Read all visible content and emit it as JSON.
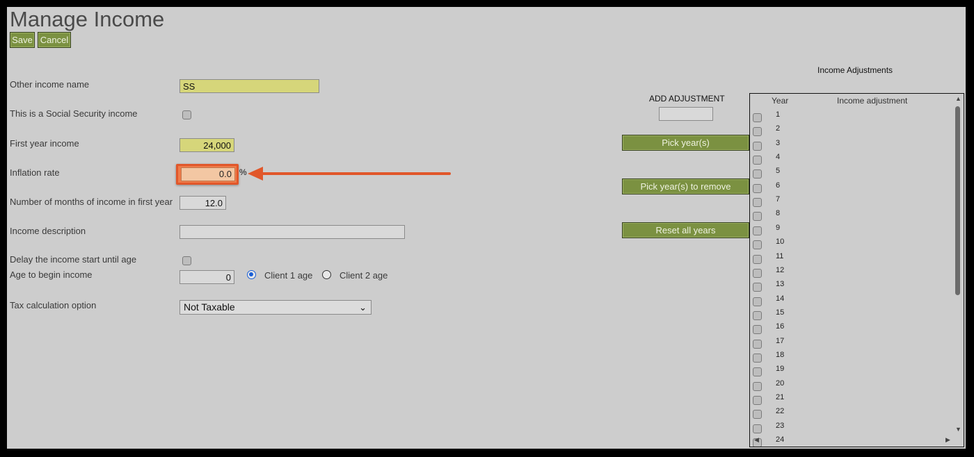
{
  "page": {
    "title": "Manage Income"
  },
  "toolbar": {
    "save_label": "Save",
    "cancel_label": "Cancel"
  },
  "form": {
    "other_income_name": {
      "label": "Other income name",
      "value": "SS"
    },
    "social_security": {
      "label": "This is a Social Security income",
      "checked": false
    },
    "first_year_income": {
      "label": "First year income",
      "value": "24,000"
    },
    "inflation_rate": {
      "label": "Inflation rate",
      "value": "0.0",
      "unit": "%"
    },
    "months_first_year": {
      "label": "Number of months of income in first year",
      "value": "12.0"
    },
    "income_description": {
      "label": "Income description",
      "value": ""
    },
    "delay_start": {
      "label": "Delay the income start until age",
      "checked": false
    },
    "age_to_begin": {
      "label": "Age to begin income",
      "value": "0",
      "option_client1": "Client 1 age",
      "option_client2": "Client 2 age",
      "selected": "Client 1 age"
    },
    "tax_option": {
      "label": "Tax calculation option",
      "selected": "Not Taxable"
    }
  },
  "adjustments": {
    "section_title": "Income Adjustments",
    "add_label": "ADD ADJUSTMENT",
    "add_value": "",
    "pick_years_label": "Pick year(s)",
    "pick_remove_label": "Pick year(s) to remove",
    "reset_label": "Reset all years",
    "col_year": "Year",
    "col_adjustment": "Income adjustment",
    "years": [
      "1",
      "2",
      "3",
      "4",
      "5",
      "6",
      "7",
      "8",
      "9",
      "10",
      "11",
      "12",
      "13",
      "14",
      "15",
      "16",
      "17",
      "18",
      "19",
      "20",
      "21",
      "22",
      "23",
      "24"
    ]
  },
  "annotation": {
    "highlight_color": "#e1572a",
    "arrow_color": "#e1572a"
  }
}
